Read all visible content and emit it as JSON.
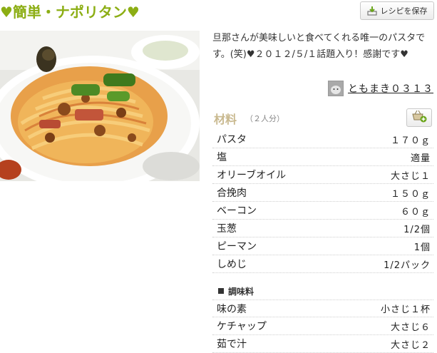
{
  "recipe": {
    "title": "♥簡単・ナポリタン♥",
    "save_label": "レシピを保存",
    "description": "旦那さんが美味しいと食べてくれる唯一のパスタです。(笑)♥２０１２/５/１話題入り！感謝です♥",
    "author": "ともまき０３１３"
  },
  "ingredients": {
    "title": "材料",
    "servings": "（２人分）",
    "main": [
      {
        "name": "パスタ",
        "qty": "１７０ｇ"
      },
      {
        "name": "塩",
        "qty": "適量"
      },
      {
        "name": "オリーブオイル",
        "qty": "大さじ１"
      },
      {
        "name": "合挽肉",
        "qty": "１５０ｇ"
      },
      {
        "name": "ベーコン",
        "qty": "６０ｇ"
      },
      {
        "name": "玉葱",
        "qty": "1/2個"
      },
      {
        "name": "ピーマン",
        "qty": "1個"
      },
      {
        "name": "しめじ",
        "qty": "1/2パック"
      }
    ],
    "seasoning_title": "調味料",
    "seasoning": [
      {
        "name": "味の素",
        "qty": "小さじ１杯"
      },
      {
        "name": "ケチャップ",
        "qty": "大さじ６"
      },
      {
        "name": "茹で汁",
        "qty": "大さじ２"
      }
    ]
  },
  "colors": {
    "title_green": "#8cae14",
    "ingredients_heading": "#c9b98f"
  },
  "icons": {
    "save": "download-icon",
    "ingredients_button": "basket-add-icon",
    "photo": "napolitan-pasta-photo"
  }
}
